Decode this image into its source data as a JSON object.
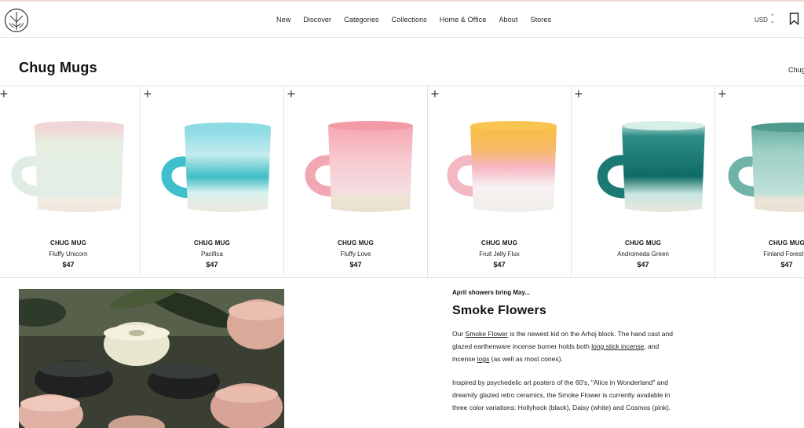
{
  "nav": {
    "items": [
      "New",
      "Discover",
      "Categories",
      "Collections",
      "Home & Office",
      "About",
      "Stores"
    ],
    "currency": "USD"
  },
  "page": {
    "title": "Chug Mugs",
    "cut_link": "Chug"
  },
  "products": [
    {
      "name": "CHUG MUG",
      "variant": "Fluffy Unicorn",
      "price": "$47"
    },
    {
      "name": "CHUG MUG",
      "variant": "Pacifica",
      "price": "$47"
    },
    {
      "name": "CHUG MUG",
      "variant": "Fluffy Love",
      "price": "$47"
    },
    {
      "name": "CHUG MUG",
      "variant": "Fruit Jelly Flux",
      "price": "$47"
    },
    {
      "name": "CHUG MUG",
      "variant": "Andromeda Green",
      "price": "$47"
    },
    {
      "name": "CHUG MUG",
      "variant": "Finland Forest G",
      "price": "$47"
    }
  ],
  "feature": {
    "eyebrow": "April showers bring May...",
    "title": "Smoke Flowers",
    "p1": {
      "a": "Our ",
      "link1": "Smoke Flower",
      "b": " is the newest kid on the Arhoj block. The hand cast and glazed earthenware incense burner holds both ",
      "link2": "long stick incense",
      "c": ", and incense ",
      "link3": "logs",
      "d": " (as well as most cones)."
    },
    "p2": "Inspired by psychedelic art posters of the 60's, \"Alice in Wonderland\" and dreamily glazed retro ceramics, the Smoke Flower is currently available in three color variations: Hollyhock (black), Daisy (white) and Cosmos (pink)."
  },
  "colors": {
    "divider": "#e2e2e2",
    "text": "#111111"
  },
  "icons": [
    "arhoj-logo-icon",
    "sort-updown-icon",
    "bookmark-icon",
    "plus-icon"
  ]
}
